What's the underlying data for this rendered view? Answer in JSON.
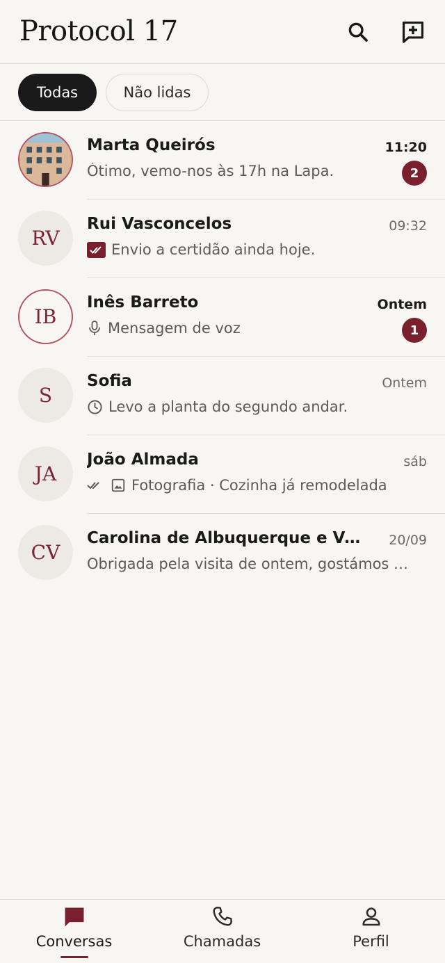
{
  "header": {
    "title": "Protocol 17",
    "search_icon": "search-icon",
    "compose_icon": "new-message-icon"
  },
  "filters": {
    "all": "Todas",
    "unread": "Não lidas",
    "active": "all"
  },
  "accent": "#7a1f2e",
  "conversations": [
    {
      "name": "Marta Queirós",
      "time": "11:20",
      "preview": "Ótimo, vemo-nos às 17h na Lapa.",
      "unread": "2",
      "avatar": "photo"
    },
    {
      "name": "Rui Vasconcelos",
      "time": "09:32",
      "preview": "Envio a certidão ainda hoje.",
      "initials": "RV",
      "status_icon": "read-receipt-icon"
    },
    {
      "name": "Inês Barreto",
      "time": "Ontem",
      "preview": "Mensagem de voz",
      "initials": "IB",
      "unread": "1",
      "status_icon": "microphone-icon"
    },
    {
      "name": "Sofia",
      "time": "Ontem",
      "preview": "Levo a planta do segundo andar.",
      "initials": "S",
      "status_icon": "clock-icon"
    },
    {
      "name": "João Almada",
      "time": "sáb",
      "preview": "Fotografia · Cozinha já remodelada",
      "initials": "JA",
      "status_icon": "double-check-icon"
    },
    {
      "name": "Carolina de Albuquerque e Vasc…",
      "time": "20/09",
      "preview": "Obrigada pela visita de ontem, gostámos …",
      "initials": "CV"
    }
  ],
  "nav": {
    "conversations": "Conversas",
    "calls": "Chamadas",
    "profile": "Perfil",
    "active": "conversations"
  }
}
